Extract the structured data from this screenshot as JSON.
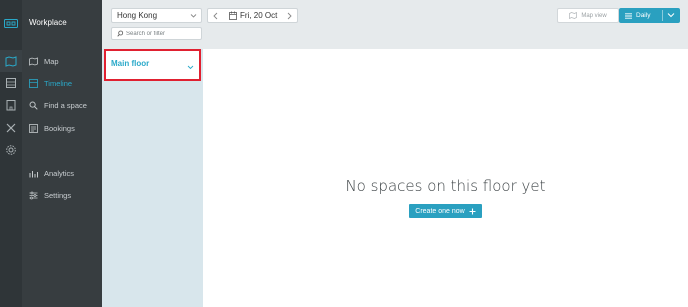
{
  "app": {
    "brand": "Workplace",
    "accent_color": "#2aa0c0",
    "highlight_color": "#e02030"
  },
  "rail": {
    "icons": [
      "logo-icon",
      "map-icon",
      "timeline-icon",
      "building-icon",
      "tools-icon",
      "gear-icon"
    ]
  },
  "nav": {
    "items": [
      {
        "label": "Map",
        "icon": "map-icon"
      },
      {
        "label": "Timeline",
        "icon": "timeline-icon",
        "active": true
      },
      {
        "label": "Find a space",
        "icon": "search-icon"
      },
      {
        "label": "Bookings",
        "icon": "bookings-icon"
      },
      {
        "label": "Analytics",
        "icon": "analytics-icon"
      },
      {
        "label": "Settings",
        "icon": "settings-icon"
      }
    ]
  },
  "toolbar": {
    "city": "Hong Kong",
    "date": "Fri, 20 Oct",
    "search_placeholder": "Search or filter",
    "map_view_label": "Map view",
    "daily_label": "Daily"
  },
  "floors": {
    "items": [
      {
        "label": "Main floor",
        "selected": true
      }
    ]
  },
  "main": {
    "empty_message": "No spaces on this floor yet",
    "create_label": "Create one now"
  }
}
